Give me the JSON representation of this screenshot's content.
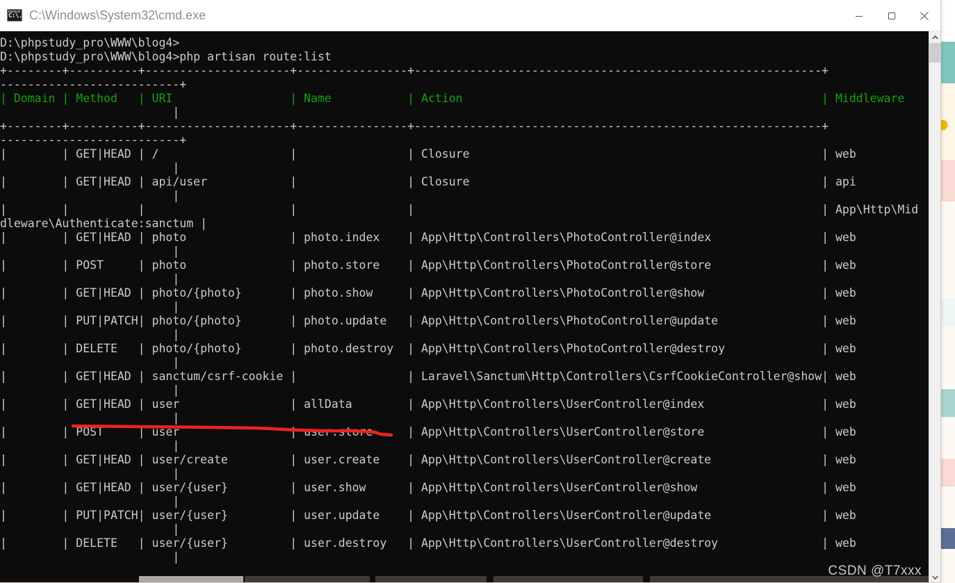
{
  "window": {
    "title": "C:\\Windows\\System32\\cmd.exe",
    "icon": "cmd-icon",
    "minimize_label": "Minimize",
    "maximize_label": "Maximize",
    "close_label": "Close"
  },
  "colors": {
    "console_bg": "#0c0c0c",
    "console_fg": "#cccccc",
    "header_fg": "#13a10e",
    "titlebar_bg": "#ffffff",
    "title_fg": "#8d8d8d",
    "annotation": "#ee2222"
  },
  "terminal": {
    "prompt_line_1": "D:\\phpstudy_pro\\WWW\\blog4>",
    "prompt_line_2": "D:\\phpstudy_pro\\WWW\\blog4>php artisan route:list",
    "command": "php artisan route:list",
    "cwd": "D:\\phpstudy_pro\\WWW\\blog4",
    "columns": [
      "Domain",
      "Method",
      "URI",
      "Name",
      "Action",
      "Middleware"
    ],
    "rule_main": "+--------+----------+------------------------+-----------------+--------------------------------------------------------------+------------+",
    "rule_wrap": "--------------------------+",
    "header_row": "| Domain | Method   | URI                    | Name            | Action                                                       | Middleware |",
    "header_wrap": "                         |",
    "rows": [
      {
        "domain": "",
        "method": "GET|HEAD",
        "uri": "/",
        "name": "",
        "action": "Closure",
        "middleware": "web"
      },
      {
        "domain": "",
        "method": "GET|HEAD",
        "uri": "api/user",
        "name": "",
        "action": "Closure",
        "middleware": "api"
      },
      {
        "domain": "",
        "method": "",
        "uri": "",
        "name": "",
        "action": "",
        "middleware": "App\\Http\\Middleware\\Authenticate:sanctum",
        "middleware_visible": "App\\Http\\Mid",
        "middleware_wrapped": "dleware\\Authenticate:sanctum"
      },
      {
        "domain": "",
        "method": "GET|HEAD",
        "uri": "photo",
        "name": "photo.index",
        "action": "App\\Http\\Controllers\\PhotoController@index",
        "middleware": "web"
      },
      {
        "domain": "",
        "method": "POST",
        "uri": "photo",
        "name": "photo.store",
        "action": "App\\Http\\Controllers\\PhotoController@store",
        "middleware": "web"
      },
      {
        "domain": "",
        "method": "GET|HEAD",
        "uri": "photo/{photo}",
        "name": "photo.show",
        "action": "App\\Http\\Controllers\\PhotoController@show",
        "middleware": "web"
      },
      {
        "domain": "",
        "method": "PUT|PATCH",
        "uri": "photo/{photo}",
        "name": "photo.update",
        "action": "App\\Http\\Controllers\\PhotoController@update",
        "middleware": "web"
      },
      {
        "domain": "",
        "method": "DELETE",
        "uri": "photo/{photo}",
        "name": "photo.destroy",
        "action": "App\\Http\\Controllers\\PhotoController@destroy",
        "middleware": "web"
      },
      {
        "domain": "",
        "method": "GET|HEAD",
        "uri": "sanctum/csrf-cookie",
        "name": "",
        "action": "Laravel\\Sanctum\\Http\\Controllers\\CsrfCookieController@show",
        "middleware": "web"
      },
      {
        "domain": "",
        "method": "GET|HEAD",
        "uri": "user",
        "name": "allData",
        "action": "App\\Http\\Controllers\\UserController@index",
        "middleware": "web"
      },
      {
        "domain": "",
        "method": "POST",
        "uri": "user",
        "name": "user.store",
        "action": "App\\Http\\Controllers\\UserController@store",
        "middleware": "web"
      },
      {
        "domain": "",
        "method": "GET|HEAD",
        "uri": "user/create",
        "name": "user.create",
        "action": "App\\Http\\Controllers\\UserController@create",
        "middleware": "web"
      },
      {
        "domain": "",
        "method": "GET|HEAD",
        "uri": "user/{user}",
        "name": "user.show",
        "action": "App\\Http\\Controllers\\UserController@show",
        "middleware": "web"
      },
      {
        "domain": "",
        "method": "PUT|PATCH",
        "uri": "user/{user}",
        "name": "user.update",
        "action": "App\\Http\\Controllers\\UserController@update",
        "middleware": "web"
      },
      {
        "domain": "",
        "method": "DELETE",
        "uri": "user/{user}",
        "name": "user.destroy",
        "action": "App\\Http\\Controllers\\UserController@destroy",
        "middleware": "web"
      }
    ],
    "body_lines": [
      "D:\\phpstudy_pro\\WWW\\blog4>",
      "D:\\phpstudy_pro\\WWW\\blog4>php artisan route:list",
      "+--------+----------+---------------------+----------------+-----------------------------------------------------------+",
      "--------------------------+",
      "| Domain | Method   | URI                 | Name           | Action                                                    | Middleware",
      "                         |",
      "+--------+----------+---------------------+----------------+-----------------------------------------------------------+",
      "--------------------------+",
      "|        | GET|HEAD | /                   |                | Closure                                                   | web",
      "                         |",
      "|        | GET|HEAD | api/user            |                | Closure                                                   | api",
      "                         |",
      "|        |          |                     |                |                                                           | App\\Http\\Mid",
      "dleware\\Authenticate:sanctum |",
      "|        | GET|HEAD | photo               | photo.index    | App\\Http\\Controllers\\PhotoController@index                | web",
      "                         |",
      "|        | POST     | photo               | photo.store    | App\\Http\\Controllers\\PhotoController@store                | web",
      "                         |",
      "|        | GET|HEAD | photo/{photo}       | photo.show     | App\\Http\\Controllers\\PhotoController@show                 | web",
      "                         |",
      "|        | PUT|PATCH| photo/{photo}       | photo.update   | App\\Http\\Controllers\\PhotoController@update               | web",
      "                         |",
      "|        | DELETE   | photo/{photo}       | photo.destroy  | App\\Http\\Controllers\\PhotoController@destroy              | web",
      "                         |",
      "|        | GET|HEAD | sanctum/csrf-cookie |                | Laravel\\Sanctum\\Http\\Controllers\\CsrfCookieController@show| web",
      "                         |",
      "|        | GET|HEAD | user                | allData        | App\\Http\\Controllers\\UserController@index                 | web",
      "                         |",
      "|        | POST     | user                | user.store     | App\\Http\\Controllers\\UserController@store                 | web",
      "                         |",
      "|        | GET|HEAD | user/create         | user.create    | App\\Http\\Controllers\\UserController@create                | web",
      "                         |",
      "|        | GET|HEAD | user/{user}         | user.show      | App\\Http\\Controllers\\UserController@show                  | web",
      "                         |",
      "|        | PUT|PATCH| user/{user}         | user.update    | App\\Http\\Controllers\\UserController@update                | web",
      "                         |",
      "|        | DELETE   | user/{user}         | user.destroy   | App\\Http\\Controllers\\UserController@destroy               | web",
      "                         |"
    ]
  },
  "annotation": {
    "type": "red-underline",
    "target_row": "user / allData",
    "color": "#ee2222"
  },
  "watermark": {
    "text": "CSDN @T7xxx"
  },
  "scrollbars": {
    "vertical_position": "top",
    "horizontal_position": "left"
  }
}
